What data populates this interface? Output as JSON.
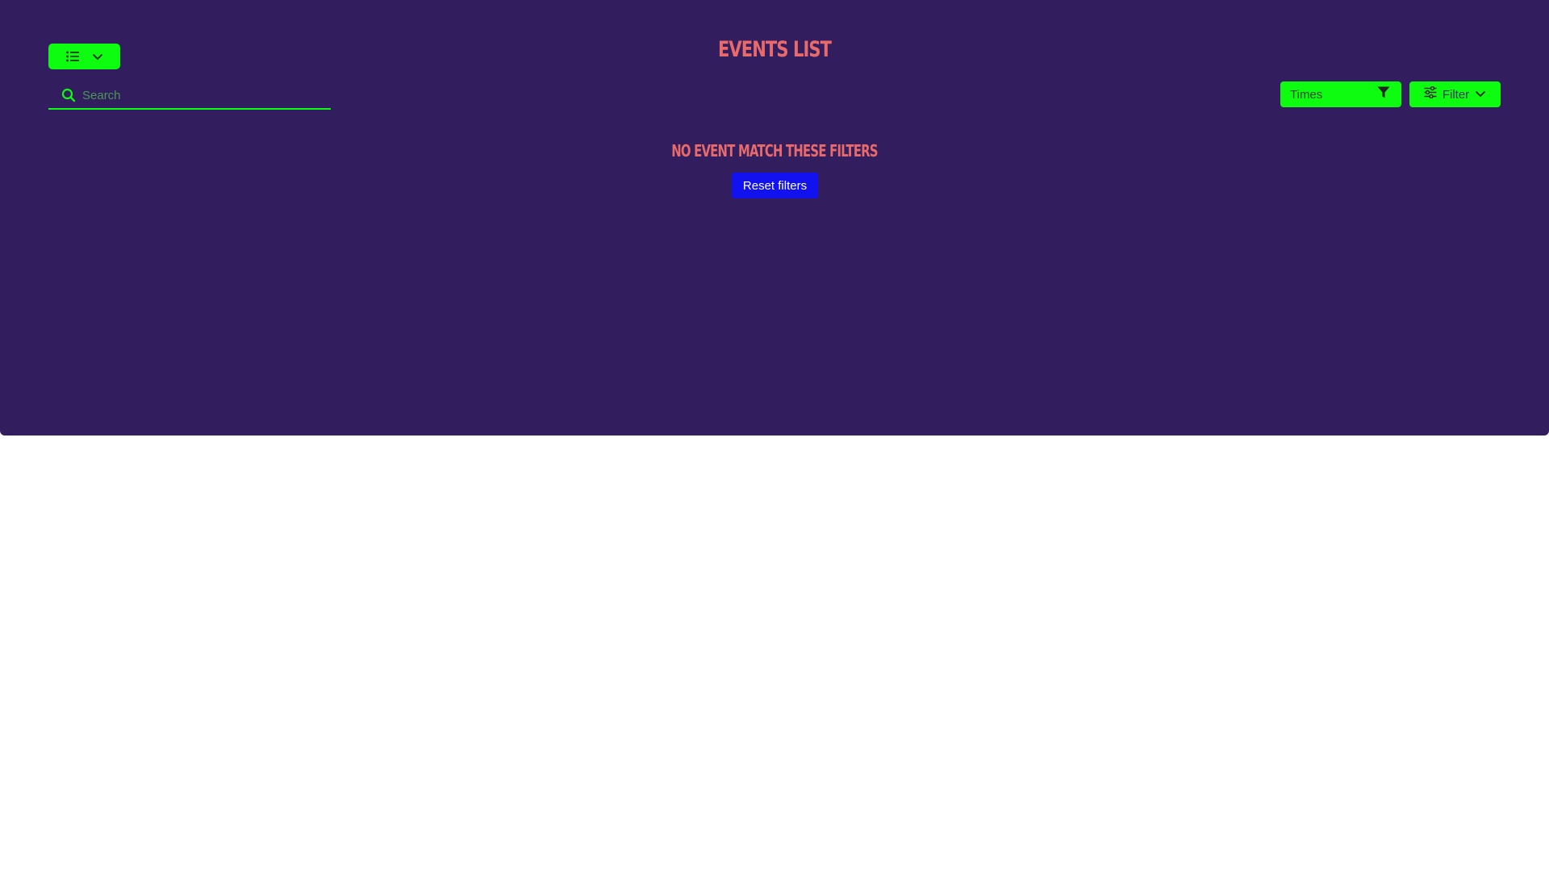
{
  "page": {
    "title": "EVENTS LIST",
    "empty_message": "NO EVENT MATCH THESE FILTERS"
  },
  "toolbar": {
    "view_toggle": {
      "icon": "list-icon",
      "chevron": "chevron-down-icon"
    },
    "search": {
      "placeholder": "Search",
      "value": "",
      "icon": "search-icon"
    },
    "times_select": {
      "label": "Times",
      "icon": "funnel-icon"
    },
    "filter_button": {
      "label": "Filter",
      "icon": "sliders-icon",
      "chevron": "chevron-down-icon"
    }
  },
  "actions": {
    "reset_label": "Reset filters"
  },
  "colors": {
    "background": "#321d5e",
    "accent": "#0dfc10",
    "heading": "#e96a6a",
    "primary_button": "#1212f0",
    "page": "#ffffff"
  }
}
